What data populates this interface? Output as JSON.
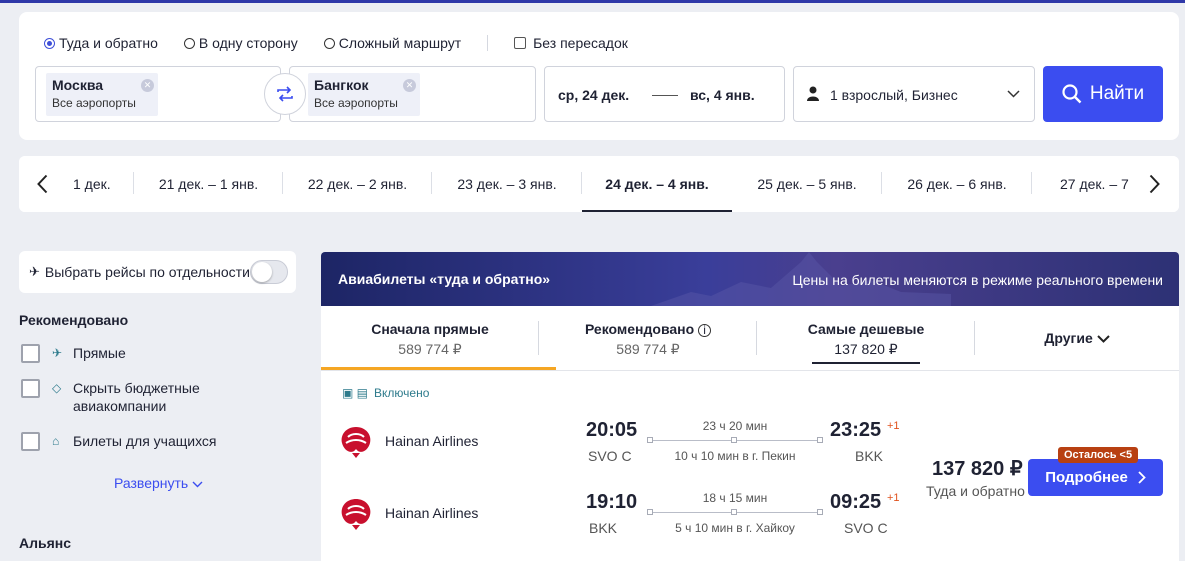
{
  "search": {
    "trip_types": [
      {
        "label": "Туда и обратно",
        "selected": true
      },
      {
        "label": "В одну сторону",
        "selected": false
      },
      {
        "label": "Сложный маршрут",
        "selected": false
      }
    ],
    "nonstop_label": "Без пересадок",
    "origin": {
      "city": "Москва",
      "sub": "Все аэропорты"
    },
    "destination": {
      "city": "Бангкок",
      "sub": "Все аэропорты"
    },
    "depart_date": "ср, 24 дек.",
    "return_date": "вс, 4 янв.",
    "passengers": "1 взрослый, Бизнес",
    "find_label": "Найти",
    "accent": "#3b4df0"
  },
  "date_strip": {
    "items": [
      "1 дек.",
      "21 дек. – 1 янв.",
      "22 дек. – 2 янв.",
      "23 дек. – 3 янв.",
      "24 дек. – 4 янв.",
      "25 дек. – 5 янв.",
      "26 дек. – 6 янв.",
      "27 дек. – 7"
    ],
    "active_index": 4
  },
  "filters": {
    "separate_label": "Выбрать рейсы по отдельности",
    "recommended_heading": "Рекомендовано",
    "items": [
      {
        "label": "Прямые",
        "icon": "plane-icon"
      },
      {
        "label": "Скрыть бюджетные авиакомпании",
        "icon": "tag-icon"
      },
      {
        "label": "Билеты для учащихся",
        "icon": "graduation-cap-icon"
      }
    ],
    "expand_label": "Развернуть",
    "alliance_heading": "Альянс"
  },
  "results": {
    "banner_title": "Авиабилеты «туда и обратно»",
    "banner_note": "Цены на билеты меняются в режиме реального времени",
    "sort_tabs": [
      {
        "title": "Сначала прямые",
        "price": "589 774 ₽"
      },
      {
        "title": "Рекомендовано",
        "price": "589 774 ₽"
      },
      {
        "title": "Самые дешевые",
        "price": "137 820 ₽"
      },
      {
        "title": "Другие",
        "price": ""
      }
    ],
    "card": {
      "included_label": "Включено",
      "price": "137 820 ₽",
      "price_note": "Туда и обратно",
      "remaining": "Осталось <5",
      "details_label": "Подробнее",
      "legs": [
        {
          "airline": "Hainan Airlines",
          "depart_time": "20:05",
          "depart_airport": "SVO C",
          "duration": "23 ч 20 мин",
          "stop": "10 ч 10 мин в г. Пекин",
          "arrive_time": "23:25",
          "day_offset": "+1",
          "arrive_airport": "BKK"
        },
        {
          "airline": "Hainan Airlines",
          "depart_time": "19:10",
          "depart_airport": "BKK",
          "duration": "18 ч 15 мин",
          "stop": "5 ч 10 мин в г. Хайкоу",
          "arrive_time": "09:25",
          "day_offset": "+1",
          "arrive_airport": "SVO C"
        }
      ]
    }
  }
}
